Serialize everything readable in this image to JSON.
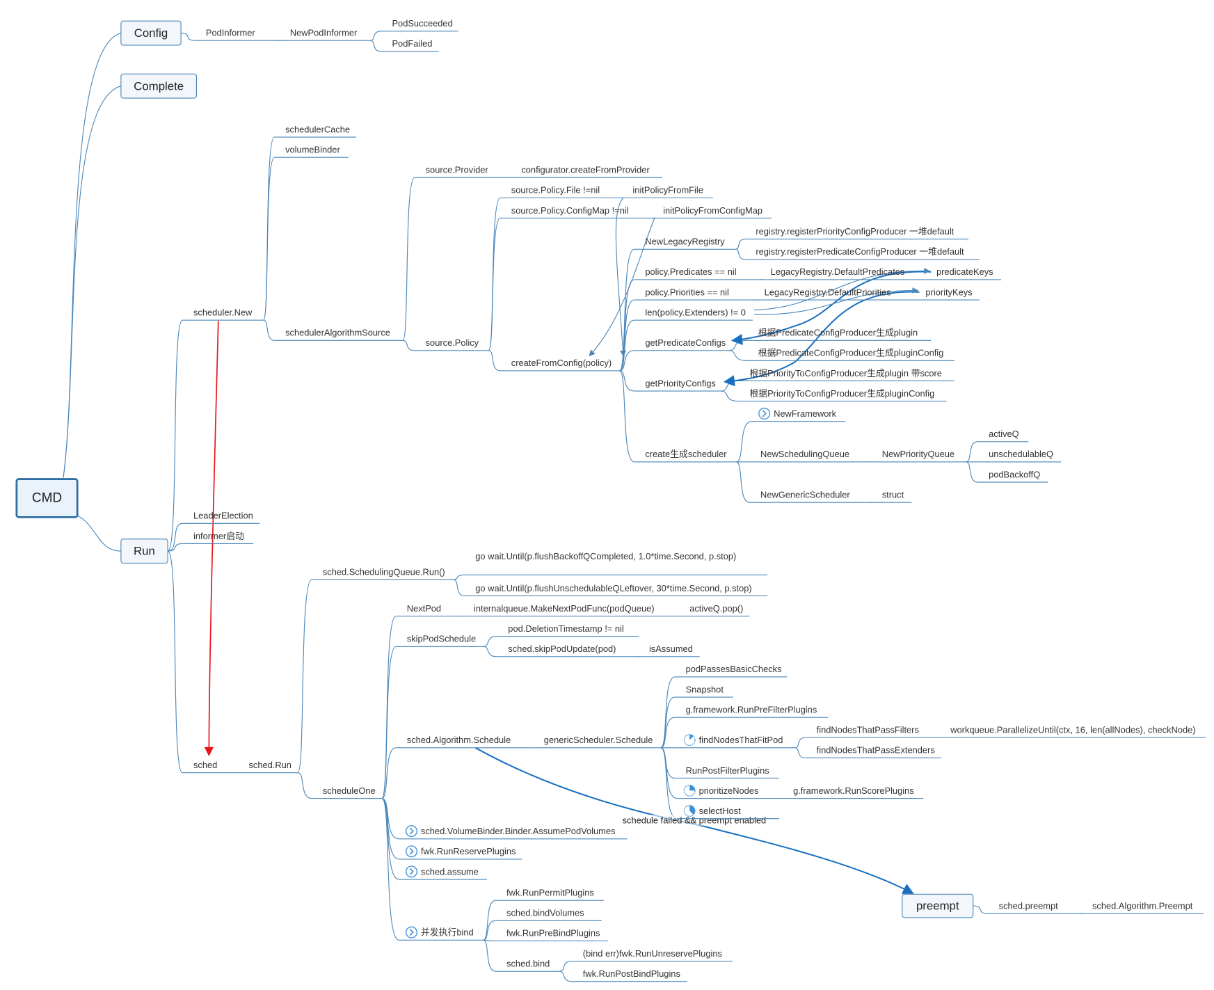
{
  "mindmap": {
    "root": {
      "id": "cmd",
      "label": "CMD"
    },
    "main_topics": [
      {
        "id": "config",
        "label": "Config"
      },
      {
        "id": "complete",
        "label": "Complete"
      },
      {
        "id": "run",
        "label": "Run"
      },
      {
        "id": "preempt",
        "label": "preempt"
      }
    ],
    "nodes": [
      {
        "id": "podinformer",
        "parent": "config",
        "label": "PodInformer"
      },
      {
        "id": "newpodinformer",
        "parent": "podinformer",
        "label": "NewPodInformer"
      },
      {
        "id": "podsucceeded",
        "parent": "newpodinformer",
        "label": "PodSucceeded"
      },
      {
        "id": "podfailed",
        "parent": "newpodinformer",
        "label": "PodFailed"
      },
      {
        "id": "schedulernew",
        "parent": "run",
        "label": "scheduler.New"
      },
      {
        "id": "schedulercache",
        "parent": "schedulernew",
        "label": "schedulerCache"
      },
      {
        "id": "volumebinder",
        "parent": "schedulernew",
        "label": "volumeBinder"
      },
      {
        "id": "algsource",
        "parent": "schedulernew",
        "label": "schedulerAlgorithmSource"
      },
      {
        "id": "sourceprovider",
        "parent": "algsource",
        "label": "source.Provider"
      },
      {
        "id": "createfromprovider",
        "parent": "sourceprovider",
        "label": "configurator.createFromProvider"
      },
      {
        "id": "sourcepolicy",
        "parent": "algsource",
        "label": "source.Policy"
      },
      {
        "id": "policyfile",
        "parent": "sourcepolicy",
        "label": "source.Policy.File !=nil"
      },
      {
        "id": "initpolicyfromfile",
        "parent": "policyfile",
        "label": "initPolicyFromFile"
      },
      {
        "id": "policyconfigmap",
        "parent": "sourcepolicy",
        "label": "source.Policy.ConfigMap !=nil"
      },
      {
        "id": "initpolicyfromconfigmap",
        "parent": "policyconfigmap",
        "label": "initPolicyFromConfigMap"
      },
      {
        "id": "createfromconfig",
        "parent": "sourcepolicy",
        "label": "createFromConfig(policy)"
      },
      {
        "id": "newlegacyregistry",
        "parent": "createfromconfig",
        "label": "NewLegacyRegistry"
      },
      {
        "id": "regpriority",
        "parent": "newlegacyregistry",
        "label": "registry.registerPriorityConfigProducer 一堆default"
      },
      {
        "id": "regpredicate",
        "parent": "newlegacyregistry",
        "label": "registry.registerPredicateConfigProducer 一堆default"
      },
      {
        "id": "predicatesnil",
        "parent": "createfromconfig",
        "label": "policy.Predicates == nil"
      },
      {
        "id": "defaultpredicates",
        "parent": "predicatesnil",
        "label": "LegacyRegistry.DefaultPredicates"
      },
      {
        "id": "predicatekeys",
        "parent": "defaultpredicates",
        "label": "predicateKeys"
      },
      {
        "id": "prioritiesnil",
        "parent": "createfromconfig",
        "label": "policy.Priorities == nil"
      },
      {
        "id": "defaultpriorities",
        "parent": "prioritiesnil",
        "label": "LegacyRegistry.DefaultPriorities"
      },
      {
        "id": "prioritykeys",
        "parent": "defaultpriorities",
        "label": "priorityKeys"
      },
      {
        "id": "extenders",
        "parent": "createfromconfig",
        "label": "len(policy.Extenders) != 0"
      },
      {
        "id": "getpredicateconfigs",
        "parent": "createfromconfig",
        "label": "getPredicateConfigs"
      },
      {
        "id": "predplugin",
        "parent": "getpredicateconfigs",
        "label": "根据PredicateConfigProducer生成plugin"
      },
      {
        "id": "predpluginconfig",
        "parent": "getpredicateconfigs",
        "label": "根据PredicateConfigProducer生成pluginConfig"
      },
      {
        "id": "getpriorityconfigs",
        "parent": "createfromconfig",
        "label": "getPriorityConfigs"
      },
      {
        "id": "priplugin",
        "parent": "getpriorityconfigs",
        "label": "根据PriorityToConfigProducer生成plugin 带score"
      },
      {
        "id": "pripluginconfig",
        "parent": "getpriorityconfigs",
        "label": "根据PriorityToConfigProducer生成pluginConfig"
      },
      {
        "id": "createscheduler",
        "parent": "createfromconfig",
        "label": "create生成scheduler"
      },
      {
        "id": "newframework",
        "parent": "createscheduler",
        "label": "NewFramework",
        "icon": "chevron-circle-icon"
      },
      {
        "id": "newschedulingqueue",
        "parent": "createscheduler",
        "label": "NewSchedulingQueue"
      },
      {
        "id": "newpriorityqueue",
        "parent": "newschedulingqueue",
        "label": "NewPriorityQueue"
      },
      {
        "id": "activeq",
        "parent": "newpriorityqueue",
        "label": "activeQ"
      },
      {
        "id": "unschedulableq",
        "parent": "newpriorityqueue",
        "label": "unschedulableQ"
      },
      {
        "id": "podbackoffq",
        "parent": "newpriorityqueue",
        "label": "podBackoffQ"
      },
      {
        "id": "newgenericscheduler",
        "parent": "createscheduler",
        "label": "NewGenericScheduler"
      },
      {
        "id": "struct",
        "parent": "newgenericscheduler",
        "label": "struct"
      },
      {
        "id": "leaderelection",
        "parent": "run",
        "label": "LeaderElection"
      },
      {
        "id": "informerstart",
        "parent": "run",
        "label": "informer启动"
      },
      {
        "id": "sched",
        "parent": "run",
        "label": "sched"
      },
      {
        "id": "schedrun",
        "parent": "sched",
        "label": "sched.Run"
      },
      {
        "id": "queuerun",
        "parent": "schedrun",
        "label": "sched.SchedulingQueue.Run()"
      },
      {
        "id": "waitbackoff",
        "parent": "queuerun",
        "label": "go wait.Until(p.flushBackoffQCompleted, 1.0*time.Second, p.stop)"
      },
      {
        "id": "waitunsched",
        "parent": "queuerun",
        "label": "go wait.Until(p.flushUnschedulableQLeftover, 30*time.Second, p.stop)"
      },
      {
        "id": "scheduleone",
        "parent": "schedrun",
        "label": "scheduleOne"
      },
      {
        "id": "nextpod",
        "parent": "scheduleone",
        "label": "NextPod"
      },
      {
        "id": "makenextpodfunc",
        "parent": "nextpod",
        "label": "internalqueue.MakeNextPodFunc(podQueue)"
      },
      {
        "id": "activeqpop",
        "parent": "makenextpodfunc",
        "label": "activeQ.pop()"
      },
      {
        "id": "skippodschedule",
        "parent": "scheduleone",
        "label": "skipPodSchedule"
      },
      {
        "id": "deletiontimestamp",
        "parent": "skippodschedule",
        "label": "pod.DeletionTimestamp != nil"
      },
      {
        "id": "skippodupdate",
        "parent": "skippodschedule",
        "label": "sched.skipPodUpdate(pod)"
      },
      {
        "id": "isassumed",
        "parent": "skippodupdate",
        "label": "isAssumed"
      },
      {
        "id": "algschedule",
        "parent": "scheduleone",
        "label": "sched.Algorithm.Schedule"
      },
      {
        "id": "genericschedule",
        "parent": "algschedule",
        "label": "genericScheduler.Schedule"
      },
      {
        "id": "basicchecks",
        "parent": "genericschedule",
        "label": "podPassesBasicChecks"
      },
      {
        "id": "snapshot",
        "parent": "genericschedule",
        "label": "Snapshot"
      },
      {
        "id": "prefilter",
        "parent": "genericschedule",
        "label": "g.framework.RunPreFilterPlugins"
      },
      {
        "id": "findnodesfit",
        "parent": "genericschedule",
        "label": "findNodesThatFitPod",
        "icon": "progress-pie-icon",
        "progress": 0.125
      },
      {
        "id": "passfilters",
        "parent": "findnodesfit",
        "label": "findNodesThatPassFilters"
      },
      {
        "id": "parallelize",
        "parent": "passfilters",
        "label": "workqueue.ParallelizeUntil(ctx, 16, len(allNodes), checkNode)"
      },
      {
        "id": "passextenders",
        "parent": "findnodesfit",
        "label": "findNodesThatPassExtenders"
      },
      {
        "id": "postfilter",
        "parent": "genericschedule",
        "label": "RunPostFilterPlugins"
      },
      {
        "id": "prioritizenodes",
        "parent": "genericschedule",
        "label": "prioritizeNodes",
        "icon": "progress-pie-icon",
        "progress": 0.25
      },
      {
        "id": "runscore",
        "parent": "prioritizenodes",
        "label": "g.framework.RunScorePlugins"
      },
      {
        "id": "selecthost",
        "parent": "genericschedule",
        "label": "selectHost",
        "icon": "progress-pie-icon",
        "progress": 0.375
      },
      {
        "id": "assumevolumes",
        "parent": "scheduleone",
        "label": "sched.VolumeBinder.Binder.AssumePodVolumes",
        "icon": "chevron-circle-icon"
      },
      {
        "id": "reserve",
        "parent": "scheduleone",
        "label": "fwk.RunReservePlugins",
        "icon": "chevron-circle-icon"
      },
      {
        "id": "assume",
        "parent": "scheduleone",
        "label": "sched.assume",
        "icon": "chevron-circle-icon"
      },
      {
        "id": "bindconcurrent",
        "parent": "scheduleone",
        "label": "并发执行bind",
        "icon": "chevron-circle-icon"
      },
      {
        "id": "permit",
        "parent": "bindconcurrent",
        "label": "fwk.RunPermitPlugins"
      },
      {
        "id": "bindvolumes",
        "parent": "bindconcurrent",
        "label": "sched.bindVolumes"
      },
      {
        "id": "prebind",
        "parent": "bindconcurrent",
        "label": "fwk.RunPreBindPlugins"
      },
      {
        "id": "schedbind",
        "parent": "bindconcurrent",
        "label": "sched.bind"
      },
      {
        "id": "unreserve",
        "parent": "schedbind",
        "label": "(bind err)fwk.RunUnreservePlugins"
      },
      {
        "id": "postbind",
        "parent": "schedbind",
        "label": "fwk.RunPostBindPlugins"
      },
      {
        "id": "schedpreempt",
        "parent": "preempt",
        "label": "sched.preempt"
      },
      {
        "id": "algpreempt",
        "parent": "schedpreempt",
        "label": "sched.Algorithm.Preempt"
      }
    ],
    "relationships": [
      {
        "from": "schedulernew",
        "to": "sched",
        "color": "#e8141b"
      },
      {
        "from": "algschedule",
        "to": "preempt",
        "label": "schedule failed && preempt enabled",
        "color": "#1a6fc0"
      },
      {
        "from": "predicatekeys",
        "to": "getpredicateconfigs",
        "color": "#1a6fc0"
      },
      {
        "from": "prioritykeys",
        "to": "getpriorityconfigs",
        "color": "#1a6fc0"
      },
      {
        "from": "extenders",
        "to": "predicatekeys",
        "color": "#4a86b8"
      },
      {
        "from": "extenders",
        "to": "prioritykeys",
        "color": "#4a86b8"
      },
      {
        "from": "initpolicyfromfile",
        "to": "createfromconfig",
        "color": "#4a86b8"
      },
      {
        "from": "initpolicyfromconfigmap",
        "to": "createfromconfig",
        "color": "#4a86b8"
      }
    ],
    "colors": {
      "line": "#4a86b8",
      "accent": "#1a6fc0",
      "red": "#e8141b"
    }
  }
}
